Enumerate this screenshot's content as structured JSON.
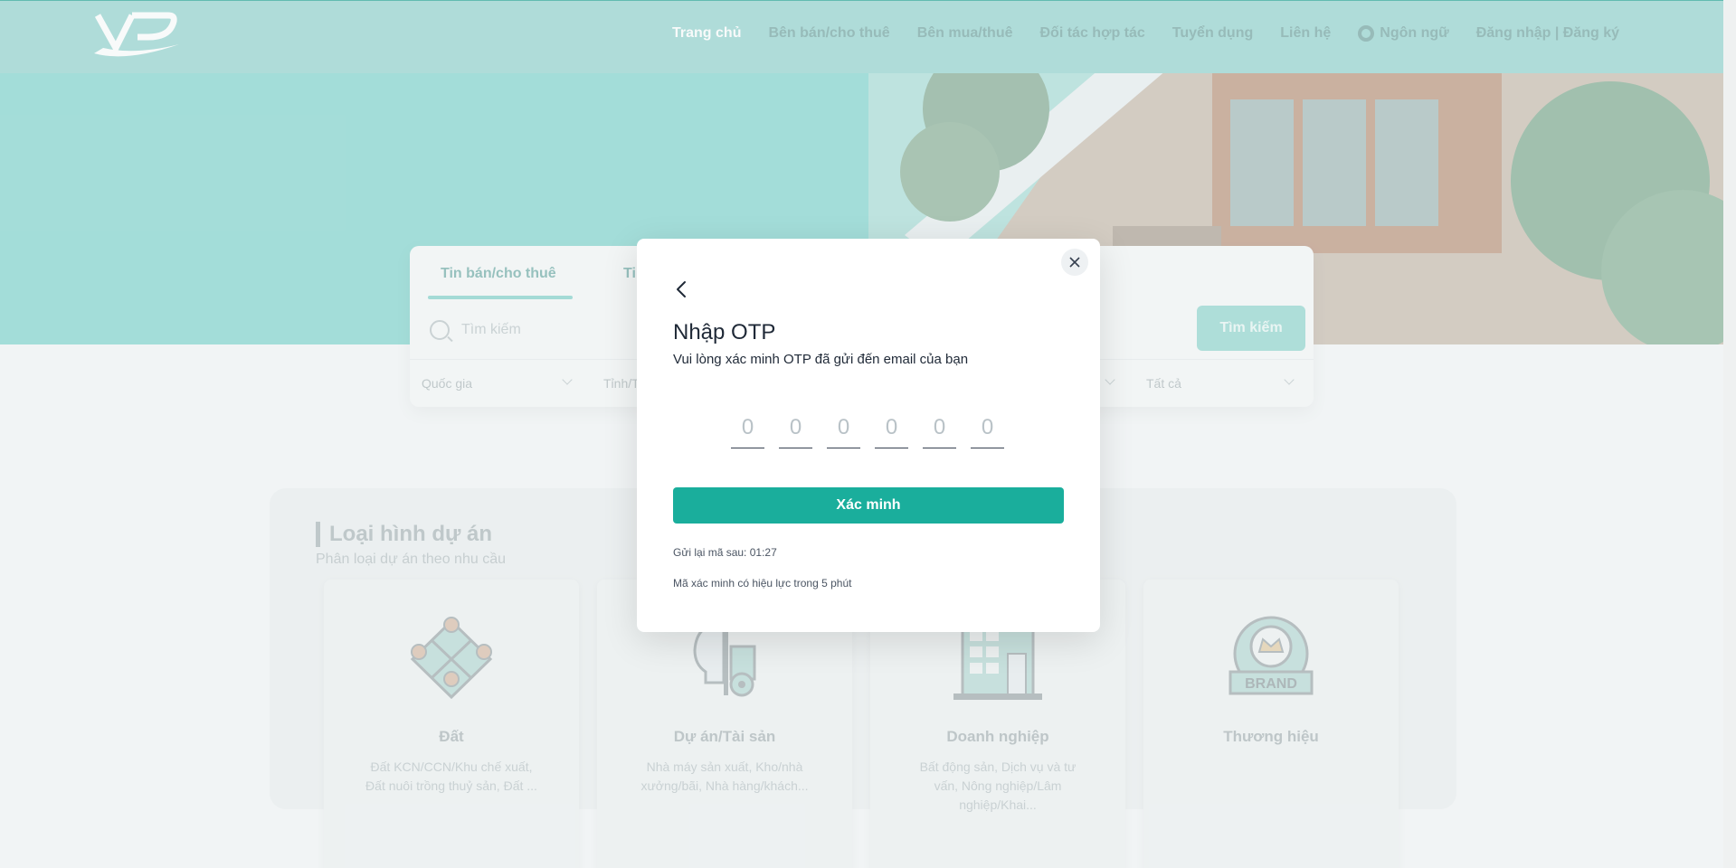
{
  "colors": {
    "brand": "#1aae9c",
    "hero_bg": "#7dd3cc",
    "modal_bg": "#ffffff"
  },
  "header": {
    "nav": [
      {
        "label": "Trang chủ",
        "active": true
      },
      {
        "label": "Bên bán/cho thuê"
      },
      {
        "label": "Bên mua/thuê"
      },
      {
        "label": "Đối tác hợp tác"
      },
      {
        "label": "Tuyển dụng"
      },
      {
        "label": "Liên hệ"
      }
    ],
    "language_label": "Ngôn ngữ",
    "auth_label": "Đăng nhập | Đăng ký"
  },
  "search": {
    "tabs": [
      "Tin bán/cho thuê",
      "Ti"
    ],
    "placeholder": "Tìm kiếm",
    "button_label": "Tìm kiếm",
    "filters": [
      "Quốc gia",
      "Tỉnh/T",
      "Tất cả"
    ]
  },
  "project_types": {
    "title": "Loại hình dự án",
    "subtitle": "Phân loại dự án theo nhu cầu",
    "cards": [
      {
        "title": "Đất",
        "desc": "Đất KCN/CCN/Khu chế xuất, Đất nuôi trồng thuỷ sản, Đất ..."
      },
      {
        "title": "Dự án/Tài sản",
        "desc": "Nhà máy sản xuất, Kho/nhà xưởng/bãi, Nhà hàng/khách..."
      },
      {
        "title": "Doanh nghiệp",
        "desc": "Bất động sản, Dịch vụ và tư vấn, Nông nghiệp/Lâm nghiệp/Khai..."
      },
      {
        "title": "Thương hiệu",
        "desc": ""
      }
    ],
    "brand_badge_text": "BRAND"
  },
  "otp_modal": {
    "title": "Nhập OTP",
    "subtitle": "Vui lòng xác minh OTP đã gửi đến email của bạn",
    "digit_placeholder": "0",
    "verify_label": "Xác minh",
    "resend_text": "Gửi lại mã sau: 01:27",
    "validity_text": "Mã xác minh có hiệu lực trong 5 phút"
  }
}
